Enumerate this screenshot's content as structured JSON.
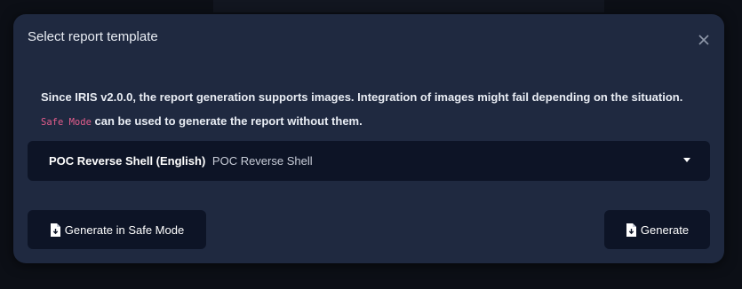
{
  "modal": {
    "title": "Select report template",
    "close_icon": "close-icon",
    "info_line1": "Since IRIS v2.0.0, the report generation supports images. Integration of images might fail depending on the situation.",
    "safe_mode_code": "Safe Mode",
    "info_line2_rest": " can be used to generate the report without them.",
    "template_select": {
      "selected_main": "POC Reverse Shell (English)",
      "selected_sub": "POC Reverse Shell"
    },
    "buttons": {
      "safe_mode_label": "Generate in Safe Mode",
      "generate_label": "Generate",
      "icon": "file-download-icon"
    }
  },
  "colors": {
    "modal_bg": "#1f2940",
    "control_bg": "#0d1426",
    "code_accent": "#e45d8c"
  }
}
